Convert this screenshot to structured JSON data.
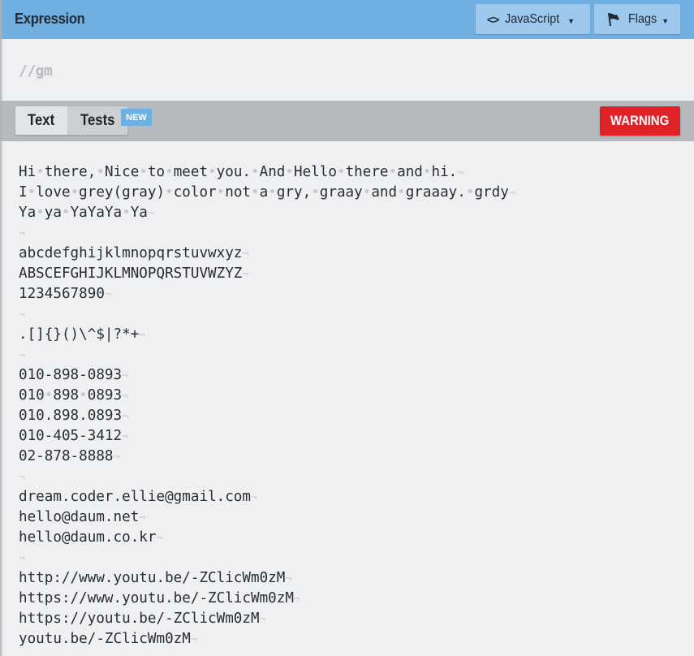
{
  "header": {
    "title": "Expression",
    "language_button": {
      "label": "JavaScript",
      "icon": "code-icon"
    },
    "flags_button": {
      "label": "Flags",
      "icon": "flag-icon"
    }
  },
  "expression": {
    "value": "//gm"
  },
  "tabbar": {
    "tabs": [
      {
        "label": "Text",
        "active": true
      },
      {
        "label": "Tests",
        "active": false,
        "badge": "NEW"
      }
    ],
    "warning_label": "WARNING"
  },
  "colors": {
    "header_bg": "#70afe0",
    "warning": "#df2226",
    "badge": "#6cb0e4"
  },
  "text_lines": [
    "Hi there, Nice to meet you. And Hello there and hi.",
    "I love grey(gray) color not a gry, graay and graaay. grdy",
    "Ya ya YaYaYa Ya",
    "",
    "abcdefghijklmnopqrstuvwxyz",
    "ABSCEFGHIJKLMNOPQRSTUVWZYZ",
    "1234567890",
    "",
    ".[]{}()\\^$|?*+",
    "",
    "010-898-0893",
    "010 898 0893",
    "010.898.0893",
    "010-405-3412",
    "02-878-8888",
    "",
    "dream.coder.ellie@gmail.com",
    "hello@daum.net",
    "hello@daum.co.kr",
    "",
    "http://www.youtu.be/-ZClicWm0zM",
    "https://www.youtu.be/-ZClicWm0zM",
    "https://youtu.be/-ZClicWm0zM",
    "youtu.be/-ZClicWm0zM"
  ]
}
